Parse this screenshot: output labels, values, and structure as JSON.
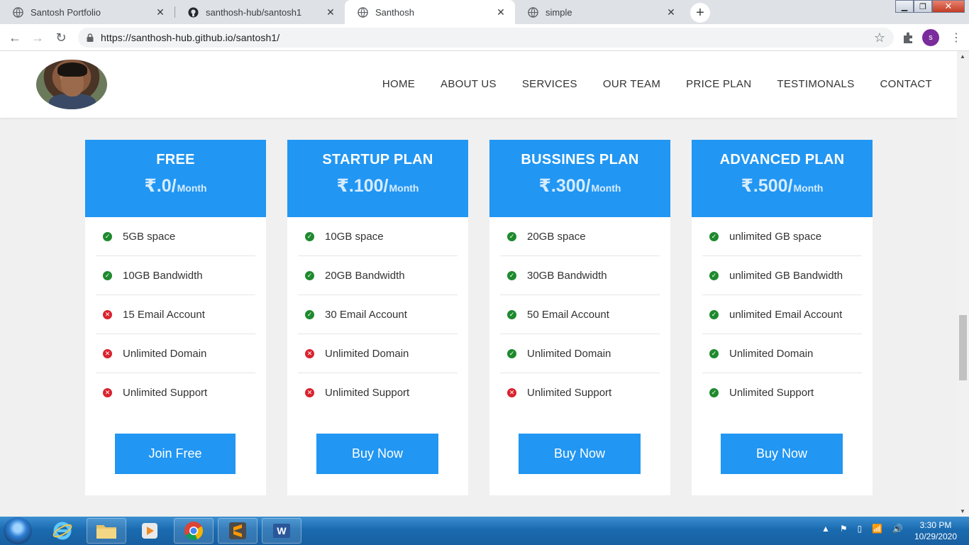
{
  "browser": {
    "tabs": [
      {
        "title": "Santosh Portfolio",
        "active": false
      },
      {
        "title": "santhosh-hub/santosh1",
        "active": false
      },
      {
        "title": "Santhosh",
        "active": true
      },
      {
        "title": "simple",
        "active": false
      }
    ],
    "url": "https://santhosh-hub.github.io/santosh1/",
    "profile_initial": "s"
  },
  "site": {
    "nav": [
      "HOME",
      "ABOUT US",
      "SERVICES",
      "OUR TEAM",
      "PRICE PLAN",
      "TESTIMONALS",
      "CONTACT"
    ],
    "plans": [
      {
        "name": "FREE",
        "price": "₹.0/",
        "period": "Month",
        "features": [
          {
            "text": "5GB space",
            "included": true
          },
          {
            "text": "10GB Bandwidth",
            "included": true
          },
          {
            "text": "15 Email Account",
            "included": false
          },
          {
            "text": "Unlimited Domain",
            "included": false
          },
          {
            "text": "Unlimited Support",
            "included": false
          }
        ],
        "button": "Join Free"
      },
      {
        "name": "STARTUP PLAN",
        "price": "₹.100/",
        "period": "Month",
        "features": [
          {
            "text": "10GB space",
            "included": true
          },
          {
            "text": "20GB Bandwidth",
            "included": true
          },
          {
            "text": "30 Email Account",
            "included": true
          },
          {
            "text": "Unlimited Domain",
            "included": false
          },
          {
            "text": "Unlimited Support",
            "included": false
          }
        ],
        "button": "Buy Now"
      },
      {
        "name": "BUSSINES PLAN",
        "price": "₹.300/",
        "period": "Month",
        "features": [
          {
            "text": "20GB space",
            "included": true
          },
          {
            "text": "30GB Bandwidth",
            "included": true
          },
          {
            "text": "50 Email Account",
            "included": true
          },
          {
            "text": "Unlimited Domain",
            "included": true
          },
          {
            "text": "Unlimited Support",
            "included": false
          }
        ],
        "button": "Buy Now"
      },
      {
        "name": "ADVANCED PLAN",
        "price": "₹.500/",
        "period": "Month",
        "features": [
          {
            "text": "unlimited GB space",
            "included": true
          },
          {
            "text": "unlimited GB Bandwidth",
            "included": true
          },
          {
            "text": "unlimited Email Account",
            "included": true
          },
          {
            "text": "Unlimited Domain",
            "included": true
          },
          {
            "text": "Unlimited Support",
            "included": true
          }
        ],
        "button": "Buy Now"
      }
    ]
  },
  "taskbar": {
    "apps": [
      "folder-icon",
      "internet-explorer-icon",
      "media-player-icon",
      "chrome-icon",
      "sublime-text-icon",
      "word-icon"
    ],
    "time": "3:30 PM",
    "date": "10/29/2020"
  },
  "colors": {
    "accent": "#2196f3",
    "check": "#1e8a2e",
    "cross": "#d9232f",
    "page_bg": "#f0f0f0"
  }
}
